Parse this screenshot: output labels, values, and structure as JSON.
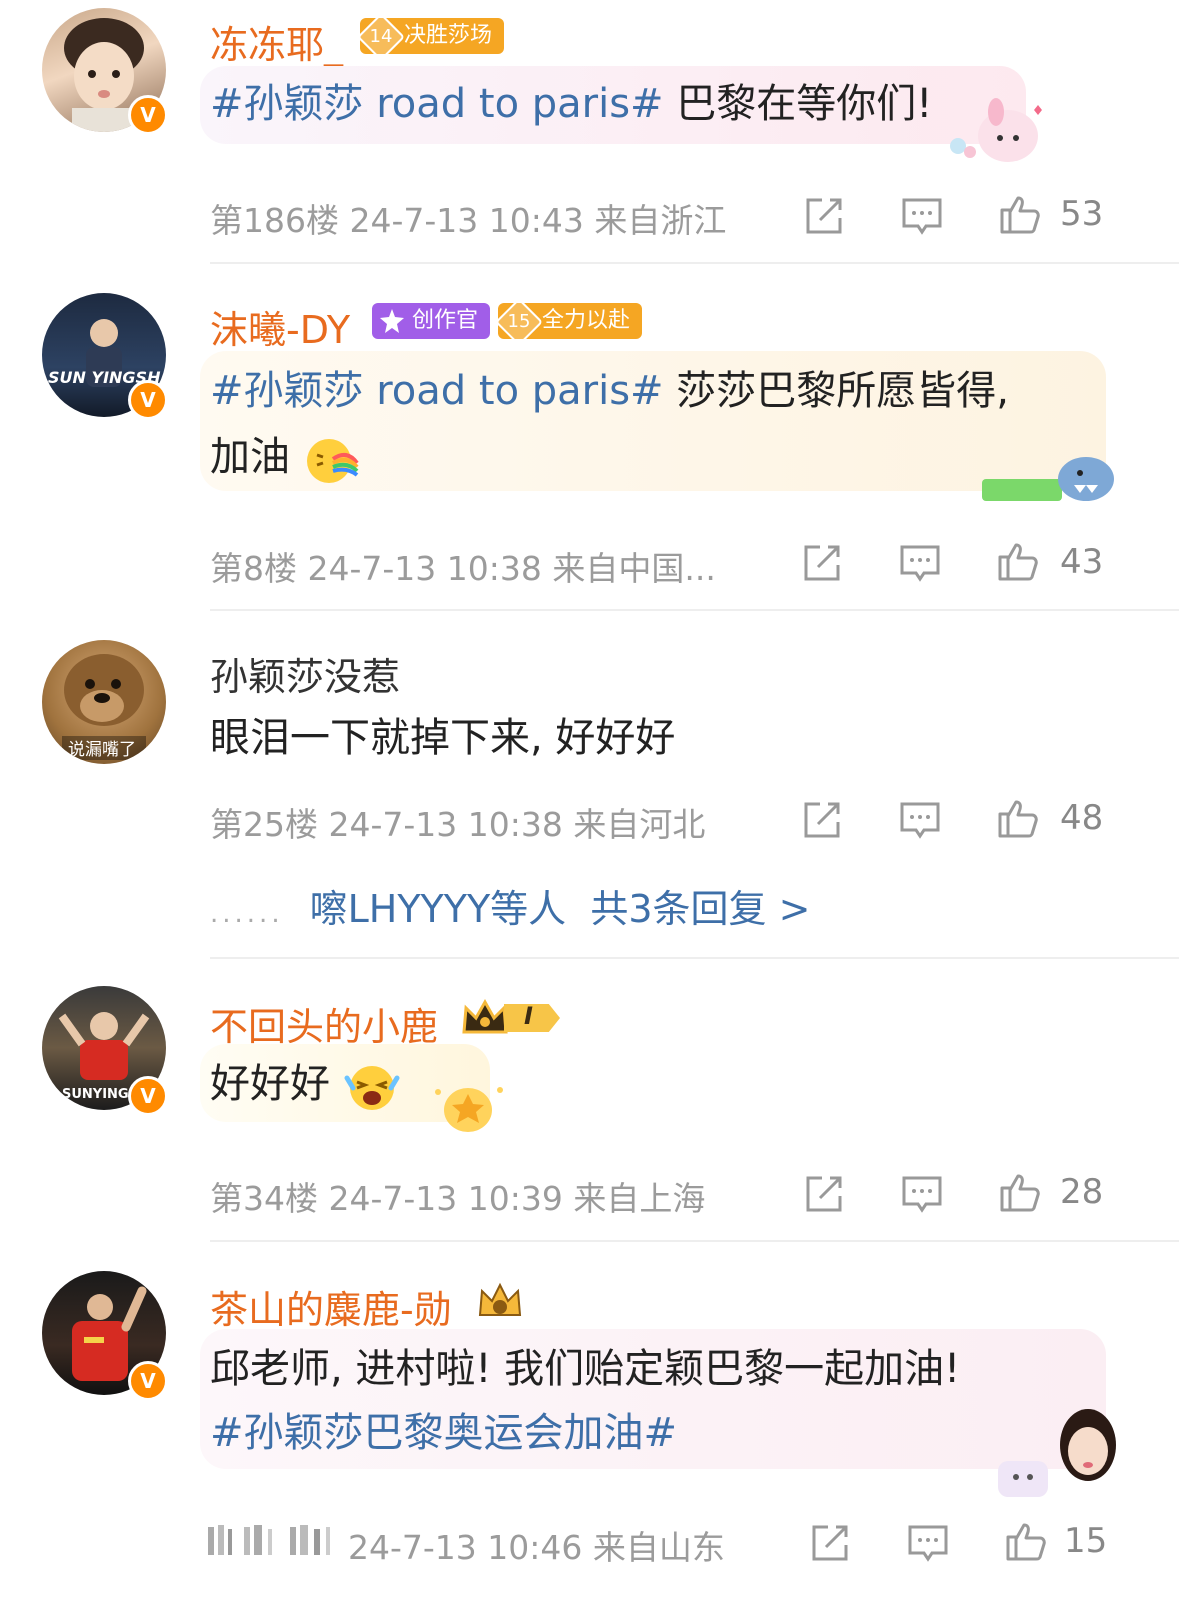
{
  "comments": [
    {
      "username": "冻冻耶_",
      "badges": [
        {
          "num": "14",
          "label": "决胜莎场",
          "color": "#f5a623"
        }
      ],
      "tag": "#孙颖莎 road to paris#",
      "text": "巴黎在等你们!",
      "text2": "",
      "meta": "第186楼 24-7-13 10:43 来自浙江",
      "likes": "53"
    },
    {
      "username": "沫曦-DY",
      "badges": [
        {
          "num": "",
          "label": "创作官",
          "color": "#a15ee8"
        },
        {
          "num": "15",
          "label": "全力以赴",
          "color": "#f5a623"
        }
      ],
      "tag": "#孙颖莎 road to paris#",
      "text": "莎莎巴黎所愿皆得,",
      "text2": "加油",
      "meta": "第8楼 24-7-13 10:38 来自中国...",
      "likes": "43"
    },
    {
      "username": "孙颖莎没惹",
      "avatar_caption": "说漏嘴了",
      "text": "眼泪一下就掉下来, 好好好",
      "meta": "第25楼 24-7-13 10:38 来自河北",
      "likes": "48",
      "replies": {
        "dots": "......",
        "who": "嚓LHYYYY等人",
        "count": "共3条回复 >"
      }
    },
    {
      "username": "不回头的小鹿",
      "rank": "I",
      "text": "好好好",
      "meta": "第34楼 24-7-13 10:39 来自上海",
      "likes": "28"
    },
    {
      "username": "茶山的麋鹿-勋",
      "text": "邱老师, 进村啦! 我们贻定颖巴黎一起加油!",
      "tag": "#孙颖莎巴黎奥运会加油#",
      "meta": "24-7-13 10:46 来自山东",
      "likes": "15"
    }
  ],
  "avatar_texts": {
    "c2": "SUN YINGSHA",
    "c4": "SUNYINGS"
  },
  "colors": {
    "username": "#e86b1f",
    "topic": "#3e6fa8",
    "meta": "#9b9b9b",
    "verified": "#ff8a00"
  }
}
